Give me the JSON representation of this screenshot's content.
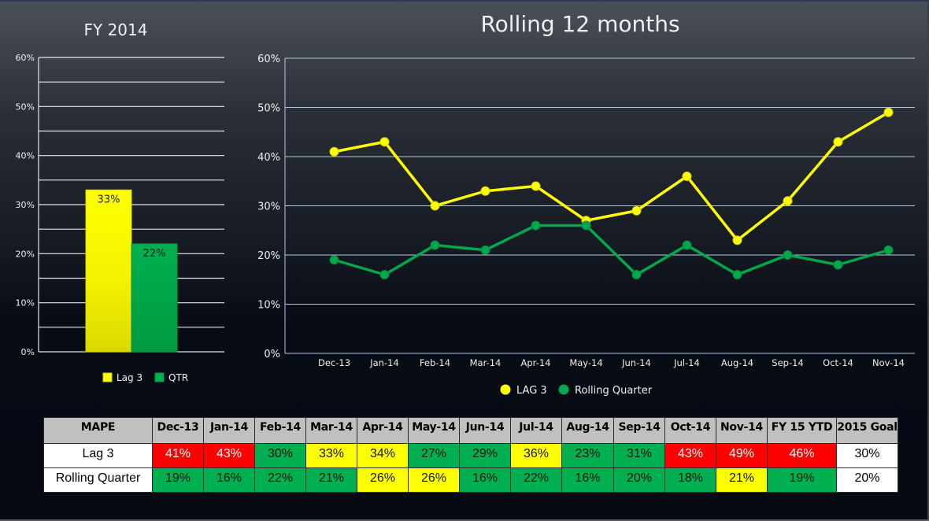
{
  "colors": {
    "lag3": "#ffff00",
    "qtr": "#00b050",
    "red": "#ff0000",
    "grid_left": "#e6e6e6",
    "grid_right": "#b4c7e7"
  },
  "chart_data": [
    {
      "type": "bar",
      "title": "FY 2014",
      "categories": [
        ""
      ],
      "series": [
        {
          "name": "Lag 3",
          "values": [
            33
          ],
          "color": "#ffff00",
          "data_labels": [
            "33%"
          ]
        },
        {
          "name": "QTR",
          "values": [
            22
          ],
          "color": "#00b050",
          "data_labels": [
            "22%"
          ]
        }
      ],
      "ylim": [
        0,
        60
      ],
      "yticks": [
        0,
        10,
        20,
        30,
        40,
        50,
        60
      ],
      "ytick_labels": [
        "0%",
        "10%",
        "20%",
        "30%",
        "40%",
        "50%",
        "60%"
      ],
      "grid": true,
      "legend": "bottom",
      "legend_labels": [
        "Lag 3",
        "QTR"
      ]
    },
    {
      "type": "line",
      "title": "Rolling 12 months",
      "categories": [
        "Dec-13",
        "Jan-14",
        "Feb-14",
        "Mar-14",
        "Apr-14",
        "May-14",
        "Jun-14",
        "Jul-14",
        "Aug-14",
        "Sep-14",
        "Oct-14",
        "Nov-14"
      ],
      "series": [
        {
          "name": "LAG 3",
          "values": [
            41,
            43,
            30,
            33,
            34,
            27,
            29,
            36,
            23,
            31,
            43,
            49
          ],
          "color": "#ffff00"
        },
        {
          "name": "Rolling Quarter",
          "values": [
            19,
            16,
            22,
            21,
            26,
            26,
            16,
            22,
            16,
            20,
            18,
            21
          ],
          "color": "#00b050"
        }
      ],
      "ylim": [
        0,
        60
      ],
      "yticks": [
        0,
        10,
        20,
        30,
        40,
        50,
        60
      ],
      "ytick_labels": [
        "0%",
        "10%",
        "20%",
        "30%",
        "40%",
        "50%",
        "60%"
      ],
      "grid": true,
      "legend": "bottom",
      "legend_labels": [
        "LAG 3",
        "Rolling Quarter"
      ]
    }
  ],
  "table": {
    "headers": [
      "MAPE",
      "Dec-13",
      "Jan-14",
      "Feb-14",
      "Mar-14",
      "Apr-14",
      "May-14",
      "Jun-14",
      "Jul-14",
      "Aug-14",
      "Sep-14",
      "Oct-14",
      "Nov-14",
      "FY 15 YTD",
      "2015 Goal"
    ],
    "rows": [
      {
        "label": "Lag 3",
        "cells": [
          {
            "value": "41%",
            "status": "red"
          },
          {
            "value": "43%",
            "status": "red"
          },
          {
            "value": "30%",
            "status": "green"
          },
          {
            "value": "33%",
            "status": "yellow"
          },
          {
            "value": "34%",
            "status": "yellow"
          },
          {
            "value": "27%",
            "status": "green"
          },
          {
            "value": "29%",
            "status": "green"
          },
          {
            "value": "36%",
            "status": "yellow"
          },
          {
            "value": "23%",
            "status": "green"
          },
          {
            "value": "31%",
            "status": "green"
          },
          {
            "value": "43%",
            "status": "red"
          },
          {
            "value": "49%",
            "status": "red"
          },
          {
            "value": "46%",
            "status": "red"
          },
          {
            "value": "30%",
            "status": "white"
          }
        ]
      },
      {
        "label": "Rolling Quarter",
        "cells": [
          {
            "value": "19%",
            "status": "green"
          },
          {
            "value": "16%",
            "status": "green"
          },
          {
            "value": "22%",
            "status": "green"
          },
          {
            "value": "21%",
            "status": "green"
          },
          {
            "value": "26%",
            "status": "yellow"
          },
          {
            "value": "26%",
            "status": "yellow"
          },
          {
            "value": "16%",
            "status": "green"
          },
          {
            "value": "22%",
            "status": "green"
          },
          {
            "value": "16%",
            "status": "green"
          },
          {
            "value": "20%",
            "status": "green"
          },
          {
            "value": "18%",
            "status": "green"
          },
          {
            "value": "21%",
            "status": "yellow"
          },
          {
            "value": "19%",
            "status": "green"
          },
          {
            "value": "20%",
            "status": "white"
          }
        ]
      }
    ]
  }
}
